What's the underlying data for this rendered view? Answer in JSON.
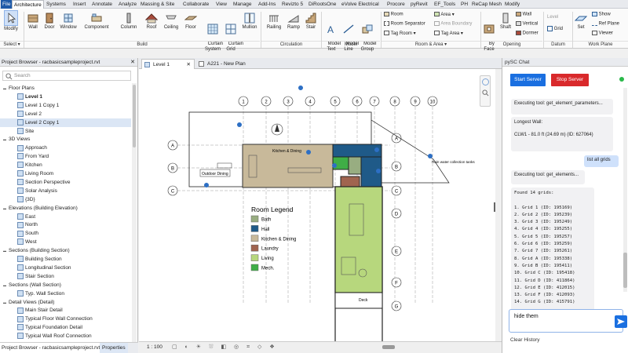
{
  "ribbon_tabs": [
    {
      "label": "File"
    },
    {
      "label": "Architecture"
    },
    {
      "label": "Systems"
    },
    {
      "label": "Insert"
    },
    {
      "label": "Annotate"
    },
    {
      "label": "Analyze"
    },
    {
      "label": "Massing & Site"
    },
    {
      "label": "Collaborate"
    },
    {
      "label": "View"
    },
    {
      "label": "Manage"
    },
    {
      "label": "Add-Ins"
    },
    {
      "label": "Revizto 5"
    },
    {
      "label": "DiRootsOne"
    },
    {
      "label": "eVolve Electrical"
    },
    {
      "label": "Procore"
    },
    {
      "label": "pyRevit"
    },
    {
      "label": "EF_Tools"
    },
    {
      "label": "PH"
    },
    {
      "label": "ReCap Mesh"
    },
    {
      "label": "Modify"
    }
  ],
  "ribbon": {
    "modify": "Modify",
    "select": "Select",
    "build": {
      "label": "Build",
      "wall": "Wall",
      "door": "Door",
      "window": "Window",
      "component": "Component",
      "column": "Column",
      "roof": "Roof",
      "ceiling": "Ceiling",
      "floor": "Floor",
      "curtain_system": "Curtain\nSystem",
      "curtain_grid": "Curtain\nGrid",
      "mullion": "Mullion"
    },
    "circulation": {
      "label": "Circulation",
      "railing": "Railing",
      "ramp": "Ramp",
      "stair": "Stair"
    },
    "model": {
      "label": "Model",
      "model_text": "Model\nText",
      "model_line": "Model\nLine",
      "model_group": "Model\nGroup"
    },
    "room_area": {
      "label": "Room & Area",
      "room": "Room",
      "room_separator": "Room  Separator",
      "tag_room": "Tag  Room",
      "area": "Area",
      "area_boundary": "Area  Boundary",
      "tag_area": "Tag  Area"
    },
    "opening": {
      "label": "Opening",
      "by_face": "By\nFace",
      "shaft": "Shaft",
      "wall": "Wall",
      "vertical": "Vertical",
      "dormer": "Dormer"
    },
    "datum": {
      "label": "Datum",
      "level": "Level",
      "grid": "Grid"
    },
    "work_plane": {
      "label": "Work Plane",
      "set": "Set",
      "show": "Show",
      "ref_plane": "Ref  Plane",
      "viewer": "Viewer"
    }
  },
  "project_browser": {
    "title": "Project Browser - racbasicsampleproject.rvt",
    "search_placeholder": "Search",
    "tree": [
      {
        "label": "Floor Plans",
        "indent": 1,
        "type": "group",
        "selected": false,
        "bold": false
      },
      {
        "label": "Level 1",
        "indent": 2,
        "type": "view",
        "selected": false,
        "bold": true
      },
      {
        "label": "Level 1 Copy 1",
        "indent": 2,
        "type": "view",
        "selected": false,
        "bold": false
      },
      {
        "label": "Level 2",
        "indent": 2,
        "type": "view",
        "selected": false,
        "bold": false
      },
      {
        "label": "Level 2 Copy 1",
        "indent": 2,
        "type": "view",
        "selected": true,
        "bold": false
      },
      {
        "label": "Site",
        "indent": 2,
        "type": "view",
        "selected": false,
        "bold": false
      },
      {
        "label": "3D Views",
        "indent": 1,
        "type": "group",
        "selected": false,
        "bold": false
      },
      {
        "label": "Approach",
        "indent": 2,
        "type": "view",
        "selected": false,
        "bold": false
      },
      {
        "label": "From Yard",
        "indent": 2,
        "type": "view",
        "selected": false,
        "bold": false
      },
      {
        "label": "Kitchen",
        "indent": 2,
        "type": "view",
        "selected": false,
        "bold": false
      },
      {
        "label": "Living Room",
        "indent": 2,
        "type": "view",
        "selected": false,
        "bold": false
      },
      {
        "label": "Section Perspective",
        "indent": 2,
        "type": "view",
        "selected": false,
        "bold": false
      },
      {
        "label": "Solar Analysis",
        "indent": 2,
        "type": "view",
        "selected": false,
        "bold": false
      },
      {
        "label": "{3D}",
        "indent": 2,
        "type": "view",
        "selected": false,
        "bold": false
      },
      {
        "label": "Elevations (Building Elevation)",
        "indent": 1,
        "type": "group",
        "selected": false,
        "bold": false
      },
      {
        "label": "East",
        "indent": 2,
        "type": "view",
        "selected": false,
        "bold": false
      },
      {
        "label": "North",
        "indent": 2,
        "type": "view",
        "selected": false,
        "bold": false
      },
      {
        "label": "South",
        "indent": 2,
        "type": "view",
        "selected": false,
        "bold": false
      },
      {
        "label": "West",
        "indent": 2,
        "type": "view",
        "selected": false,
        "bold": false
      },
      {
        "label": "Sections (Building Section)",
        "indent": 1,
        "type": "group",
        "selected": false,
        "bold": false
      },
      {
        "label": "Building Section",
        "indent": 2,
        "type": "view",
        "selected": false,
        "bold": false
      },
      {
        "label": "Longitudinal Section",
        "indent": 2,
        "type": "view",
        "selected": false,
        "bold": false
      },
      {
        "label": "Stair Section",
        "indent": 2,
        "type": "view",
        "selected": false,
        "bold": false
      },
      {
        "label": "Sections (Wall Section)",
        "indent": 1,
        "type": "group",
        "selected": false,
        "bold": false
      },
      {
        "label": "Typ. Wall Section",
        "indent": 2,
        "type": "view",
        "selected": false,
        "bold": false
      },
      {
        "label": "Detail Views (Detail)",
        "indent": 1,
        "type": "group",
        "selected": false,
        "bold": false
      },
      {
        "label": "Main Stair Detail",
        "indent": 2,
        "type": "view",
        "selected": false,
        "bold": false
      },
      {
        "label": "Typical Floor Wall Connection",
        "indent": 2,
        "type": "view",
        "selected": false,
        "bold": false
      },
      {
        "label": "Typical Foundation Detail",
        "indent": 2,
        "type": "view",
        "selected": false,
        "bold": false
      },
      {
        "label": "Typical Wall Roof Connection",
        "indent": 2,
        "type": "view",
        "selected": false,
        "bold": false
      },
      {
        "label": "Renderings",
        "indent": 1,
        "type": "group",
        "selected": false,
        "bold": false
      }
    ],
    "bottom_tabs": [
      "Project Browser - racbasicsampleproject.rvt",
      "Properties"
    ]
  },
  "view_tabs": [
    {
      "label": "Level 1",
      "active": true
    },
    {
      "label": "A221 - New Plan",
      "active": false
    }
  ],
  "drawing": {
    "grid_numbers": [
      "1",
      "2",
      "3",
      "4",
      "5",
      "6",
      "7",
      "8",
      "9",
      "10"
    ],
    "grid_letters_left": [
      "A",
      "B",
      "C"
    ],
    "grid_letters_right": [
      "A",
      "B",
      "C",
      "D",
      "E",
      "F",
      "G"
    ],
    "labels": {
      "outdoor_dining": "Outdoor Dining",
      "kitchen_dining": "Kitchen & Dining",
      "rain_water": "Rain water\ncollection tanks",
      "deck": "Deck"
    },
    "legend_title": "Room Legend",
    "legend": [
      {
        "name": "Bath",
        "color": "#98ad81"
      },
      {
        "name": "Hall",
        "color": "#1f5a88"
      },
      {
        "name": "Kitchen & Dining",
        "color": "#c8b99a"
      },
      {
        "name": "Laundry",
        "color": "#a0644f"
      },
      {
        "name": "Living",
        "color": "#b7d77d"
      },
      {
        "name": "Mech.",
        "color": "#3fae46"
      }
    ]
  },
  "view_status": {
    "scale": "1 : 100"
  },
  "chat": {
    "title": "pySC Chat",
    "start_label": "Start Server",
    "stop_label": "Stop Server",
    "status_color": "#2ab94a",
    "messages": [
      {
        "role": "bot",
        "text": "Executing tool: get_element_parameters..."
      },
      {
        "role": "bot",
        "text": "Longest Wall:\n\nCLW1 - 81.0 ft (24.69 m) (ID: 627064)"
      },
      {
        "role": "user",
        "text": "list all grids"
      },
      {
        "role": "bot",
        "text": "Executing tool: get_elements..."
      },
      {
        "role": "bot",
        "text": "Found 14 grids:\n\n1. Grid 1 (ID: 195169)\n2. Grid 2 (ID: 195239)\n3. Grid 3 (ID: 195249)\n4. Grid 4 (ID: 195255)\n5. Grid 5 (ID: 195257)\n6. Grid 6 (ID: 195259)\n7. Grid 7 (ID: 195261)\n8. Grid A (ID: 195338)\n9. Grid B (ID: 195411)\n10. Grid C (ID: 195418)\n11. Grid D (ID: 411864)\n12. Grid E (ID: 412015)\n13. Grid F (ID: 412093)\n14. Grid G (ID: 415791)"
      }
    ],
    "input_value": "hide them",
    "clear_label": "Clear History"
  }
}
